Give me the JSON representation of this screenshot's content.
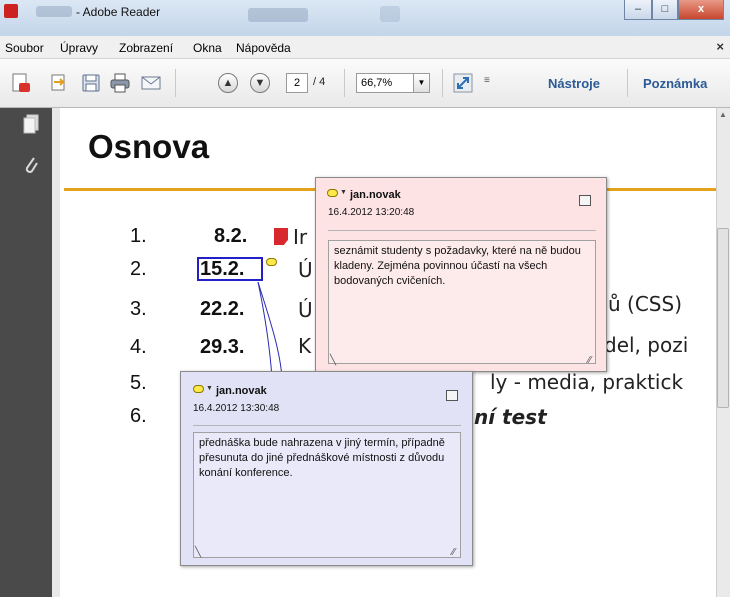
{
  "window": {
    "title": "- Adobe Reader",
    "minimize": "–",
    "maximize": "□",
    "close": "x"
  },
  "menu": {
    "items": [
      "Soubor",
      "Úpravy",
      "Zobrazení",
      "Okna",
      "Nápověda"
    ],
    "close": "×"
  },
  "toolbar": {
    "page_current": "2",
    "page_total": "/ 4",
    "zoom": "66,7%",
    "tools": "Nástroje",
    "comment": "Poznámka"
  },
  "document": {
    "title": "Osnova",
    "items": [
      {
        "num": "1.",
        "date": "8.2.",
        "text": "Ir"
      },
      {
        "num": "2.",
        "date": "15.2.",
        "text": "Ú"
      },
      {
        "num": "3.",
        "date": "22.2.",
        "text": "Ú"
      },
      {
        "num": "4.",
        "date": "29.3.",
        "text": "K"
      },
      {
        "num": "5.",
        "date": "",
        "text": ""
      },
      {
        "num": "6.",
        "date": "",
        "text": ""
      }
    ],
    "behind": {
      "item3_tail": "ů (CSS)",
      "item4_tail": "del, pozi",
      "item5_tail": "ly - media, praktick",
      "item6_tail": "ní test"
    }
  },
  "notes": [
    {
      "author": "jan.novak",
      "date": "16.4.2012 13:20:48",
      "text": "seznámit studenty s požadavky, které na ně budou kladeny. Zejména povinnou účastí na všech bodovaných cvičeních."
    },
    {
      "author": "jan.novak",
      "date": "16.4.2012 13:30:48",
      "text": "přednáška bude nahrazena v jiný termín, případně přesunuta do jiné přednáškové místnosti z důvodu konání konference."
    }
  ],
  "colors": {
    "title_rule": "#e3a21a",
    "note1_bg": "#fde3e3",
    "note2_bg": "#e2e2f7",
    "highlight_box": "#2121c7",
    "link_blue": "#2c5a96"
  }
}
